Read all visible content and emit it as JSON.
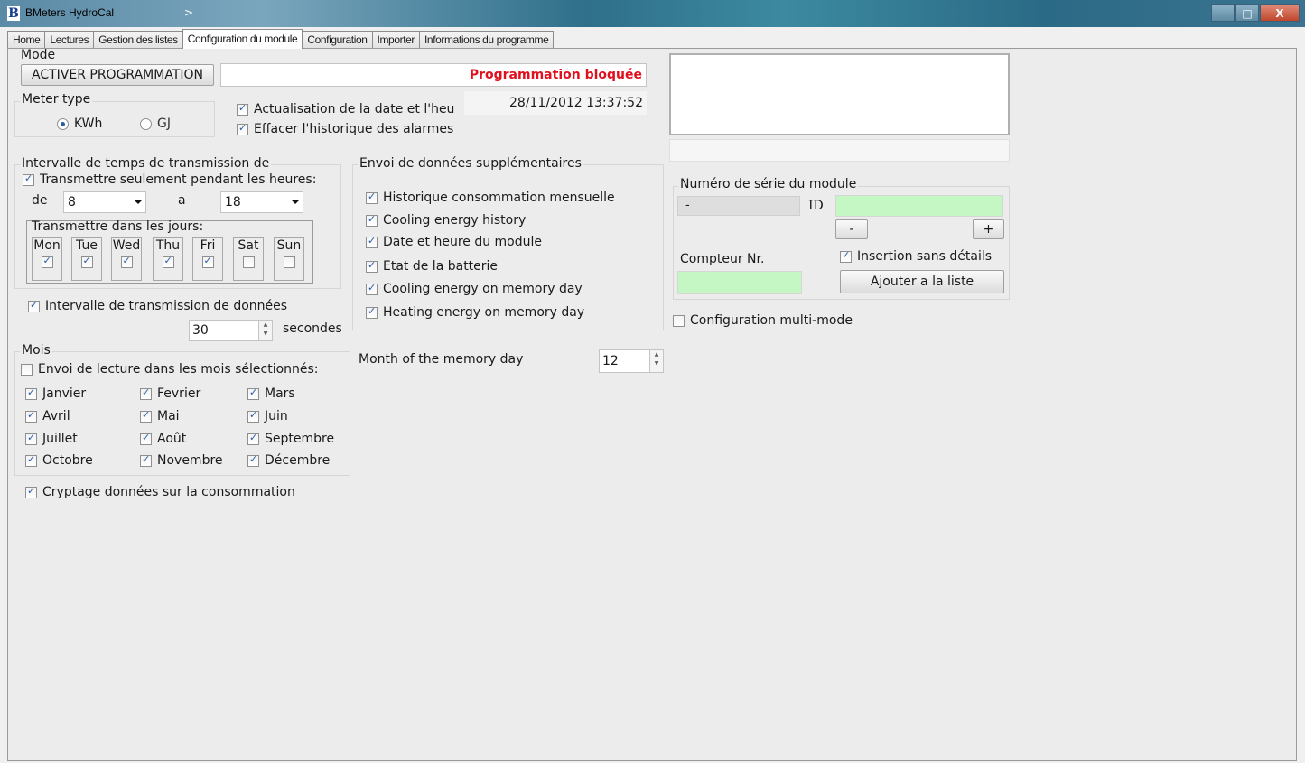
{
  "window": {
    "title": "BMeters HydroCal",
    "logo_letter": "B",
    "chevron": ">",
    "controls": {
      "minimize": "—",
      "maximize": "□",
      "close": "X"
    }
  },
  "tabs": [
    "Home",
    "Lectures",
    "Gestion des listes",
    "Configuration du module",
    "Configuration",
    "Importer",
    "Informations du programme"
  ],
  "active_tab": "Configuration du module",
  "mode": {
    "title": "Mode",
    "button": "ACTIVER PROGRAMMATION",
    "status": "Programmation bloquée",
    "status_color": "#e0101e"
  },
  "meter_type": {
    "title": "Meter type",
    "options": [
      "KWh",
      "GJ"
    ],
    "selected": "KWh"
  },
  "datetime": {
    "update_label": "Actualisation de la date et l'heu",
    "value": "28/11/2012 13:37:52",
    "clear_alarms_label": "Effacer l'historique des alarmes"
  },
  "transmission_interval": {
    "title": "Intervalle de temps de transmission de",
    "only_hours_label": "Transmettre seulement pendant les heures:",
    "from_label": "de",
    "from_value": "8",
    "to_label": "a",
    "to_value": "18",
    "days_title": "Transmettre dans les jours:",
    "days": [
      {
        "label": "Mon",
        "checked": true
      },
      {
        "label": "Tue",
        "checked": true
      },
      {
        "label": "Wed",
        "checked": true
      },
      {
        "label": "Thu",
        "checked": true
      },
      {
        "label": "Fri",
        "checked": true
      },
      {
        "label": "Sat",
        "checked": false
      },
      {
        "label": "Sun",
        "checked": false
      }
    ],
    "data_interval_label": "Intervalle de transmission de données",
    "data_interval_value": "30",
    "data_interval_unit": "secondes"
  },
  "months": {
    "title": "Mois",
    "send_selected_label": "Envoi de lecture dans les mois sélectionnés:",
    "list": [
      "Janvier",
      "Fevrier",
      "Mars",
      "Avril",
      "Mai",
      "Juin",
      "Juillet",
      "Août",
      "Septembre",
      "Octobre",
      "Novembre",
      "Décembre"
    ]
  },
  "encryption_label": "Cryptage données sur la consommation",
  "extra_data": {
    "title": "Envoi de données supplémentaires",
    "items": [
      "Historique consommation mensuelle",
      "Cooling energy history",
      "Date et heure du module",
      "Etat de la batterie",
      "Cooling energy on memory day",
      "Heating energy on memory day"
    ]
  },
  "memory_day": {
    "label": "Month of the memory day",
    "value": "12"
  },
  "serial": {
    "title": "Numéro de série du module",
    "serial_value": "-",
    "id_label": "ID",
    "minus": "-",
    "plus": "+",
    "counter_label": "Compteur Nr.",
    "insert_label": "Insertion sans détails",
    "add_button": "Ajouter a la liste"
  },
  "multimode_label": "Configuration multi-mode"
}
